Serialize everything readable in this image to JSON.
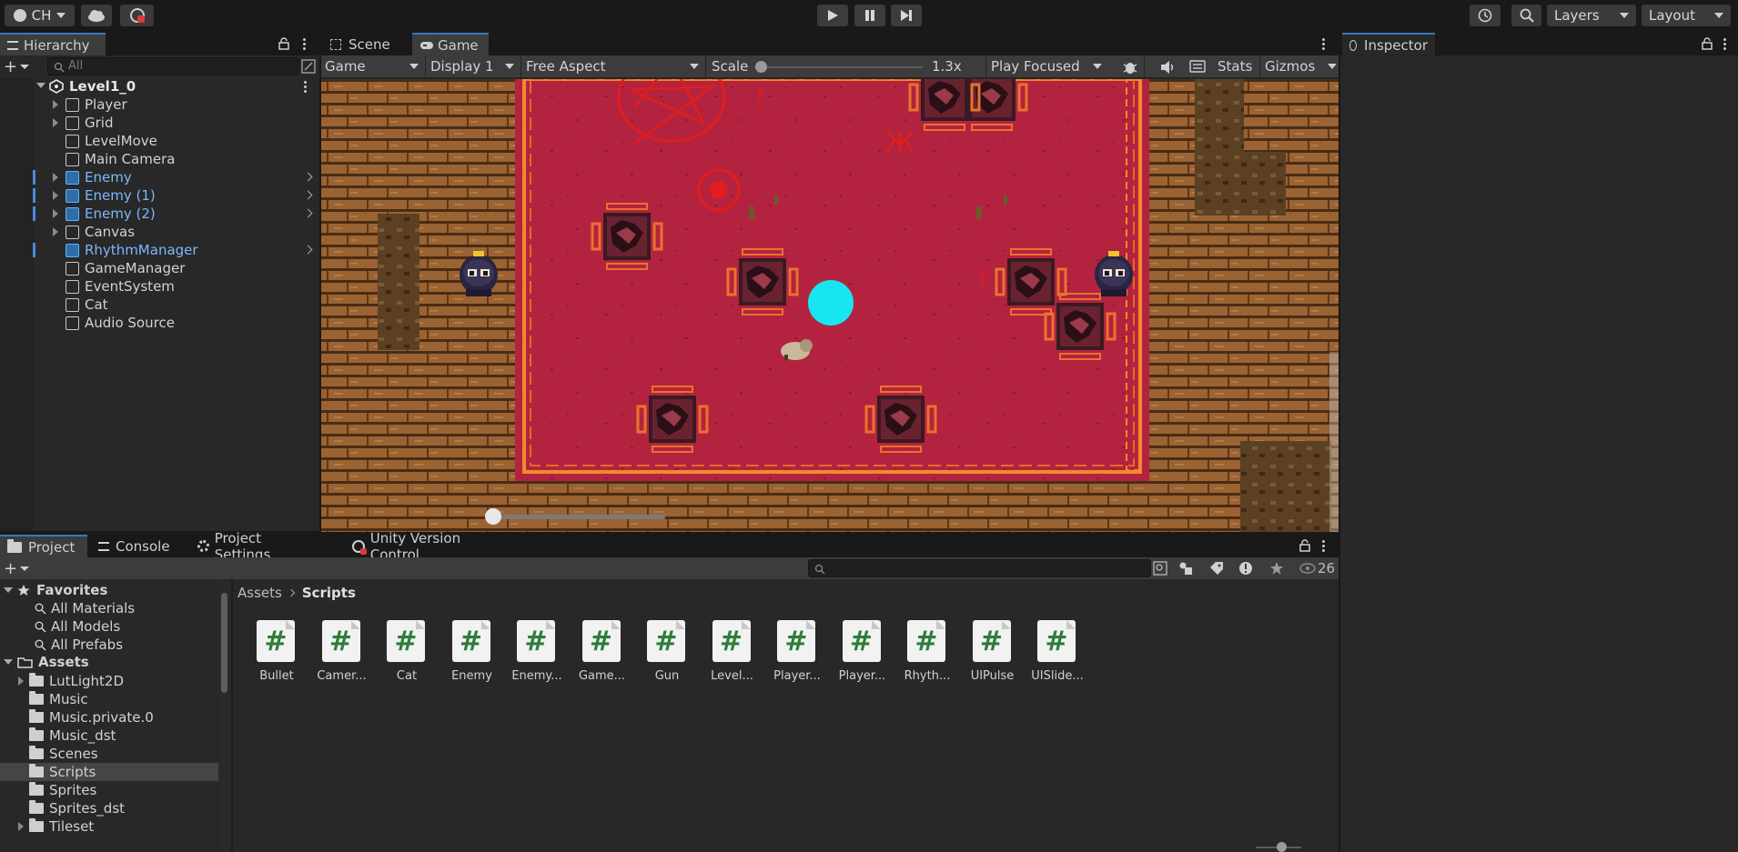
{
  "toolbar": {
    "account": "CH",
    "layers": "Layers",
    "layout": "Layout"
  },
  "hierarchy": {
    "tab": "Hierarchy",
    "search_placeholder": "All",
    "root": "Level1_0",
    "items": [
      {
        "label": "Player",
        "prefab": false,
        "expandable": true
      },
      {
        "label": "Grid",
        "prefab": false,
        "expandable": true
      },
      {
        "label": "LevelMove",
        "prefab": false,
        "expandable": false
      },
      {
        "label": "Main Camera",
        "prefab": false,
        "expandable": false
      },
      {
        "label": "Enemy",
        "prefab": true,
        "expandable": true
      },
      {
        "label": "Enemy (1)",
        "prefab": true,
        "expandable": true
      },
      {
        "label": "Enemy (2)",
        "prefab": true,
        "expandable": true
      },
      {
        "label": "Canvas",
        "prefab": false,
        "expandable": true
      },
      {
        "label": "RhythmManager",
        "prefab": true,
        "expandable": false
      },
      {
        "label": "GameManager",
        "prefab": false,
        "expandable": false
      },
      {
        "label": "EventSystem",
        "prefab": false,
        "expandable": false
      },
      {
        "label": "Cat",
        "prefab": false,
        "expandable": false
      },
      {
        "label": "Audio Source",
        "prefab": false,
        "expandable": false
      }
    ]
  },
  "center": {
    "tabs": [
      "Scene",
      "Game"
    ],
    "game_toolbar": {
      "mode": "Game",
      "display": "Display 1",
      "aspect": "Free Aspect",
      "scale_label": "Scale",
      "scale_value": "1.3x",
      "play_mode": "Play Focused",
      "stats": "Stats",
      "gizmos": "Gizmos"
    }
  },
  "inspector": {
    "tab": "Inspector"
  },
  "bottom": {
    "tabs": [
      "Project",
      "Console",
      "Project Settings",
      "Unity Version Control"
    ],
    "hidden_count": "26",
    "breadcrumb": [
      "Assets",
      "Scripts"
    ],
    "favorites": {
      "title": "Favorites",
      "items": [
        "All Materials",
        "All Models",
        "All Prefabs"
      ]
    },
    "assets": {
      "title": "Assets",
      "items": [
        {
          "label": "LutLight2D",
          "expandable": true
        },
        {
          "label": "Music",
          "expandable": false
        },
        {
          "label": "Music.private.0",
          "expandable": false
        },
        {
          "label": "Music_dst",
          "expandable": false
        },
        {
          "label": "Scenes",
          "expandable": false
        },
        {
          "label": "Scripts",
          "expandable": false,
          "selected": true
        },
        {
          "label": "Sprites",
          "expandable": false
        },
        {
          "label": "Sprites_dst",
          "expandable": false
        },
        {
          "label": "Tileset",
          "expandable": true
        }
      ]
    },
    "scripts": [
      "Bullet",
      "Camer...",
      "Cat",
      "Enemy",
      "Enemy...",
      "Game...",
      "Gun",
      "Level...",
      "Player...",
      "Player...",
      "Rhyth...",
      "UIPulse",
      "UISlide..."
    ]
  },
  "colors": {
    "accent": "#3a79bb",
    "prefab_text": "#7cb7ff",
    "arena_red": "#b3233f",
    "wood": "#8a5a2e",
    "cyan_orb": "#17e6f0"
  }
}
